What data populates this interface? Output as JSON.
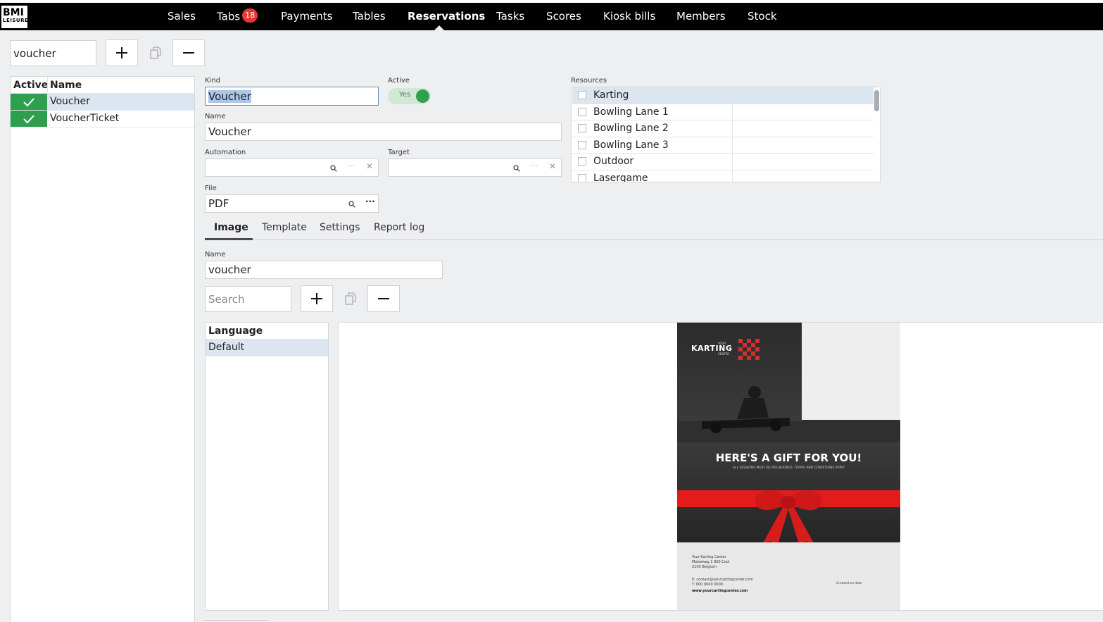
{
  "app": {
    "logo_line1": "BMI",
    "logo_line2": "LEISURE"
  },
  "nav": {
    "items": [
      {
        "label": "Sales"
      },
      {
        "label": "Tabs",
        "badge": "18"
      },
      {
        "label": "Payments"
      },
      {
        "label": "Tables"
      },
      {
        "label": "Reservations",
        "active": true
      },
      {
        "label": "Tasks"
      },
      {
        "label": "Scores"
      },
      {
        "label": "Kiosk bills"
      },
      {
        "label": "Members"
      },
      {
        "label": "Stock"
      }
    ]
  },
  "left": {
    "search_value": "voucher",
    "table_headers": {
      "active": "Active",
      "name": "Name"
    },
    "rows": [
      {
        "name": "Voucher",
        "active": true,
        "selected": true
      },
      {
        "name": "VoucherTicket",
        "active": true,
        "selected": false
      }
    ]
  },
  "form": {
    "kind_label": "Kind",
    "kind_value": "Voucher",
    "active_label": "Active",
    "active_toggle_text": "Yes",
    "name_label": "Name",
    "name_value": "Voucher",
    "automation_label": "Automation",
    "automation_value": "",
    "target_label": "Target",
    "target_value": "",
    "file_label": "File",
    "file_value": "PDF",
    "resources_label": "Resources",
    "resources": [
      "Karting",
      "Bowling Lane 1",
      "Bowling Lane 2",
      "Bowling Lane 3",
      "Outdoor",
      "Lasergame"
    ]
  },
  "tabs": [
    {
      "label": "Image",
      "active": true
    },
    {
      "label": "Template"
    },
    {
      "label": "Settings"
    },
    {
      "label": "Report log"
    }
  ],
  "image_tab": {
    "name_label": "Name",
    "name_value": "voucher",
    "search_placeholder": "Search",
    "language_header": "Language",
    "languages": [
      "Default"
    ]
  },
  "voucher_preview": {
    "brand_small_top": "YOUR",
    "brand": "KARTING",
    "brand_small_bottom": "CENTER",
    "headline": "HERE'S A GIFT FOR YOU!",
    "subline": "ALL SESSIONS MUST BE PRE-BOOKED. TERMS AND CONDITIONS APPLY",
    "address_1": "Your Karting Center",
    "address_2": "Molsewag 1 600 Cool",
    "address_3": "2100 Belgium",
    "email": "E: contact@yourcartingcenter.com",
    "phone": "T: 000 0000 0000",
    "website": "www.yourcartingcenter.com",
    "date_note": "Created on date"
  }
}
